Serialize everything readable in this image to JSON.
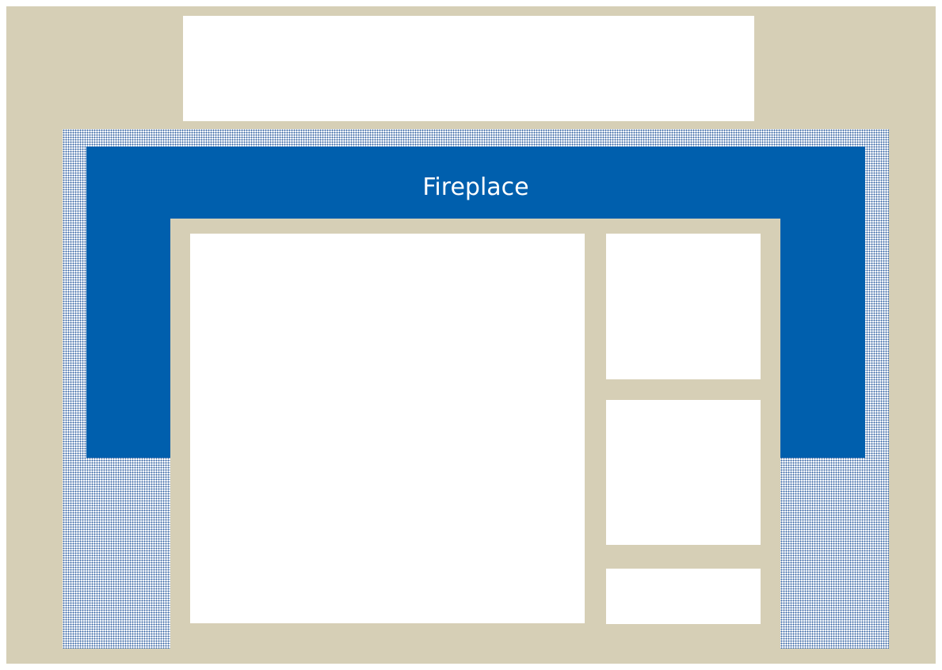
{
  "colors": {
    "frame_beige": "#d6cfb6",
    "fireplace_blue": "#005fad",
    "dot_blue": "#2f5fa0",
    "panel_white": "#ffffff"
  },
  "fireplace": {
    "label": "Fireplace"
  }
}
